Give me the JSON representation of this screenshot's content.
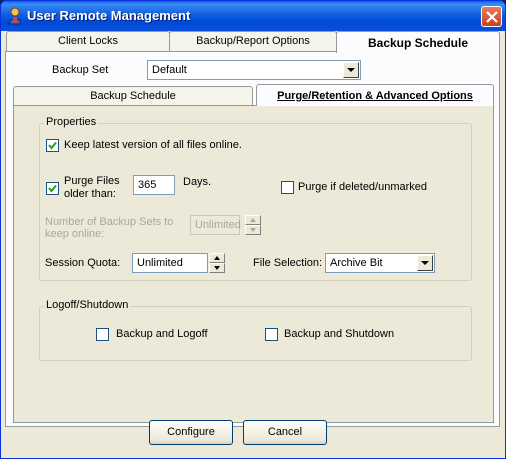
{
  "window": {
    "title": "User Remote Management",
    "icon": "user-gear-icon"
  },
  "tabs": [
    {
      "label": "Client Locks"
    },
    {
      "label": "Backup/Report Options"
    },
    {
      "label": "Backup Schedule"
    }
  ],
  "backup_set": {
    "label": "Backup Set",
    "value": "Default"
  },
  "subtabs": [
    {
      "label": "Backup Schedule"
    },
    {
      "label": "Purge/Retention & Advanced Options"
    }
  ],
  "properties": {
    "title": "Properties",
    "keep_latest": {
      "label": "Keep latest version of all files online.",
      "checked": true
    },
    "purge_files": {
      "label_line1": "Purge Files",
      "label_line2": "older than:",
      "checked": true,
      "days": "365",
      "days_label": "Days."
    },
    "purge_deleted": {
      "label": "Purge if deleted/unmarked",
      "checked": false
    },
    "num_backup_sets": {
      "label_line1": "Number of Backup Sets to",
      "label_line2": "keep online:",
      "value": "Unlimited"
    },
    "session_quota": {
      "label": "Session Quota:",
      "value": "Unlimited"
    },
    "file_selection": {
      "label": "File Selection:",
      "value": "Archive Bit"
    }
  },
  "logoff": {
    "title": "Logoff/Shutdown",
    "backup_logoff": {
      "label": "Backup and Logoff",
      "checked": false
    },
    "backup_shutdown": {
      "label": "Backup and Shutdown",
      "checked": false
    }
  },
  "buttons": {
    "configure": "Configure",
    "cancel": "Cancel"
  }
}
